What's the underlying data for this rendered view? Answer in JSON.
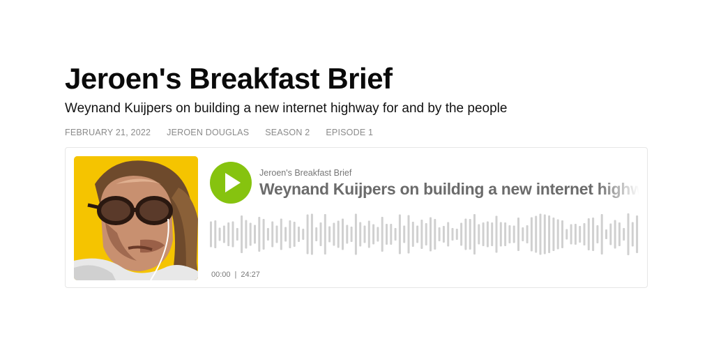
{
  "show": {
    "title": "Jeroen's Breakfast Brief"
  },
  "episode": {
    "subtitle": "Weynand Kuijpers on building a new internet highway for and by the people",
    "meta": {
      "date": "FEBRUARY 21, 2022",
      "author": "JEROEN DOUGLAS",
      "season": "SEASON 2",
      "episode": "EPISODE 1"
    }
  },
  "player": {
    "show_name": "Jeroen's Breakfast Brief",
    "episode_title": "Weynand Kuijpers on building a new internet highway for and by the people",
    "current_time": "00:00",
    "separator": "|",
    "duration": "24:27",
    "progress": 0,
    "play_icon": "play-icon",
    "accent_color": "#86c30f",
    "waveform_color": "#d0d0d0"
  },
  "artwork": {
    "background_color": "#f5c400"
  }
}
